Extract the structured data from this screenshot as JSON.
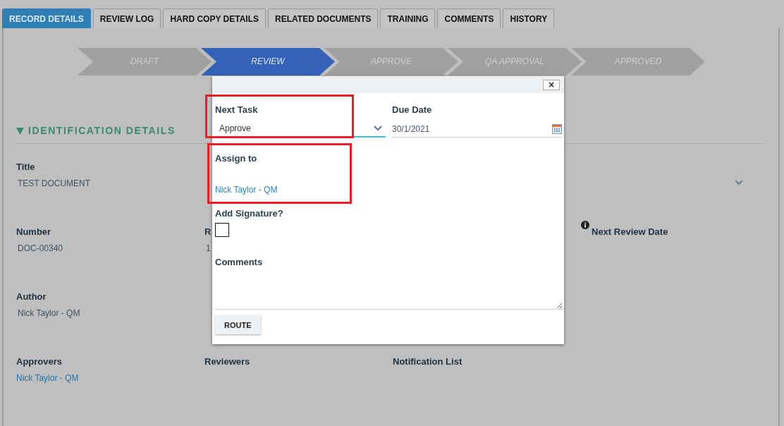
{
  "tabs": [
    {
      "label": "RECORD DETAILS",
      "selected": true
    },
    {
      "label": "REVIEW LOG",
      "selected": false
    },
    {
      "label": "HARD COPY DETAILS",
      "selected": false
    },
    {
      "label": "RELATED DOCUMENTS",
      "selected": false
    },
    {
      "label": "TRAINING",
      "selected": false
    },
    {
      "label": "COMMENTS",
      "selected": false
    },
    {
      "label": "HISTORY",
      "selected": false
    }
  ],
  "stages": [
    {
      "label": "DRAFT",
      "selected": false
    },
    {
      "label": "REVIEW",
      "selected": true
    },
    {
      "label": "APPROVE",
      "selected": false
    },
    {
      "label": "QA APPROVAL",
      "selected": false
    },
    {
      "label": "APPROVED",
      "selected": false
    }
  ],
  "section": {
    "title": "IDENTIFICATION DETAILS",
    "expanded": true
  },
  "rows": [
    {
      "fields": [
        {
          "label": "Title",
          "value": "TEST DOCUMENT",
          "kind": "text"
        },
        {
          "kind": "dropdown"
        }
      ]
    },
    {
      "fields": [
        {
          "label": "Number",
          "value": "DOC-00340",
          "kind": "text"
        },
        {
          "label": "R",
          "value": "1",
          "kind": "text"
        },
        {
          "kind": "empty"
        },
        {
          "label": "Next Review Date",
          "kind": "info"
        }
      ]
    },
    {
      "fields": [
        {
          "label": "Author",
          "value": "Nick Taylor - QM",
          "kind": "text"
        }
      ]
    },
    {
      "fields": [
        {
          "label": "Approvers",
          "value": "Nick Taylor - QM",
          "kind": "link"
        },
        {
          "label": "Reviewers",
          "kind": "text"
        },
        {
          "label": "Notification List",
          "kind": "text"
        }
      ]
    }
  ],
  "dialog": {
    "close": "×",
    "next_task": {
      "label": "Next Task",
      "value": "Approve",
      "highlighted": true
    },
    "due_date": {
      "label": "Due Date",
      "value": "30/1/2021"
    },
    "assign_to": {
      "label": "Assign to",
      "value": "Nick Taylor - QM",
      "highlighted": true
    },
    "signature": {
      "label": "Add Signature?",
      "checked": false
    },
    "comments": {
      "label": "Comments"
    },
    "button": "ROUTE"
  }
}
